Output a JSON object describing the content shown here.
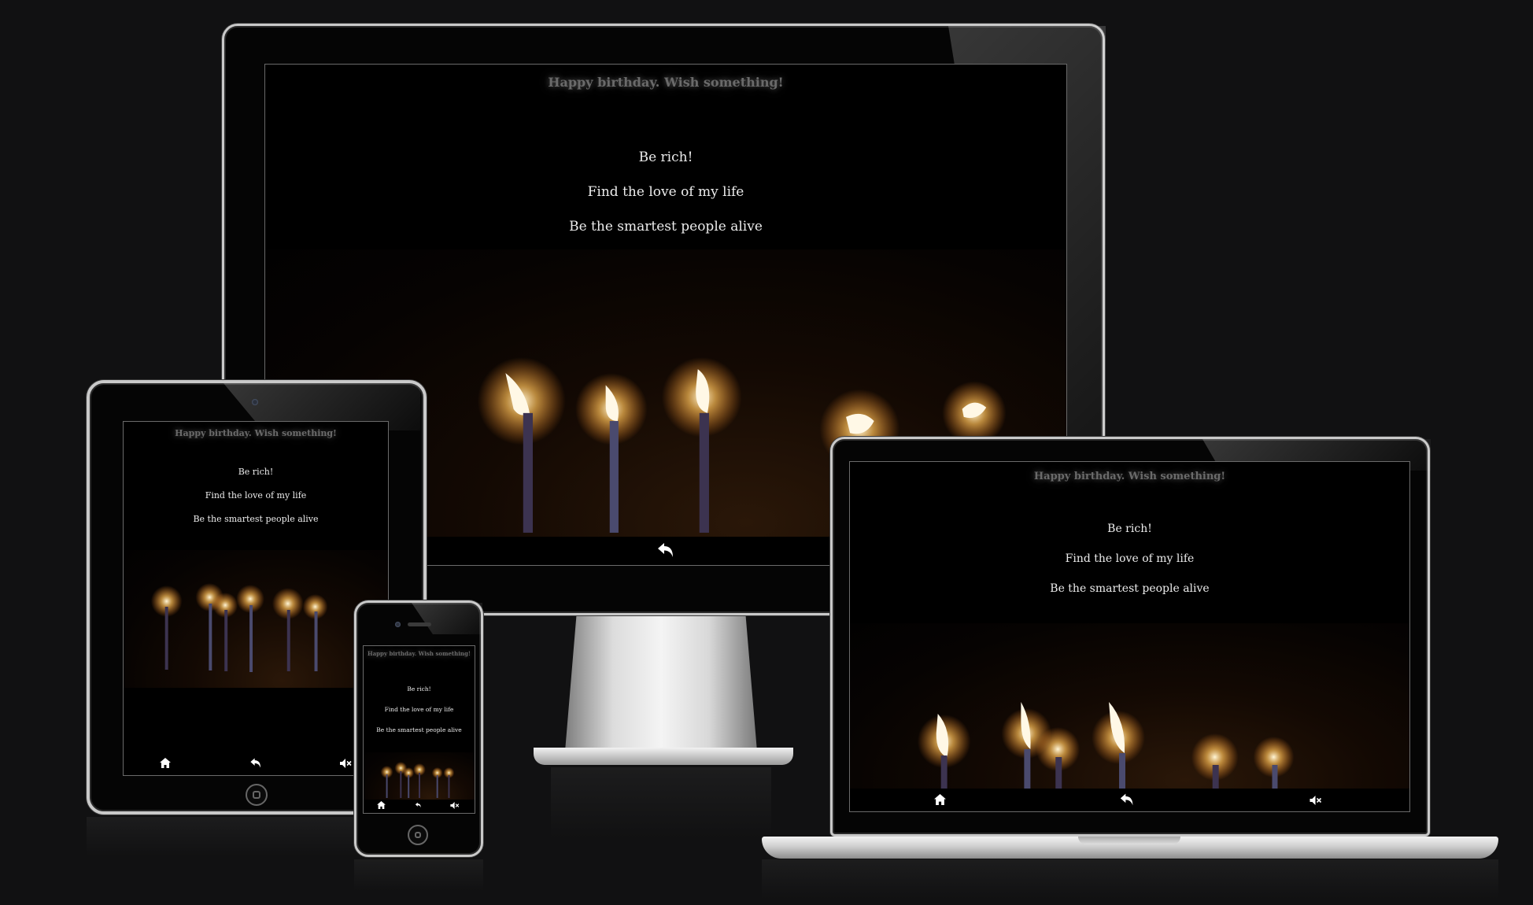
{
  "page": {
    "background": "#111112",
    "title_color": "#6a6a6a",
    "wish_color": "#ececec"
  },
  "app": {
    "title": "Happy birthday. Wish something!",
    "wishes": [
      "Be rich!",
      "Find the love of my life",
      "Be the smartest people alive"
    ],
    "icons": {
      "home": "home-icon",
      "back": "undo-arrow-icon",
      "mute": "volume-mute-icon"
    }
  }
}
